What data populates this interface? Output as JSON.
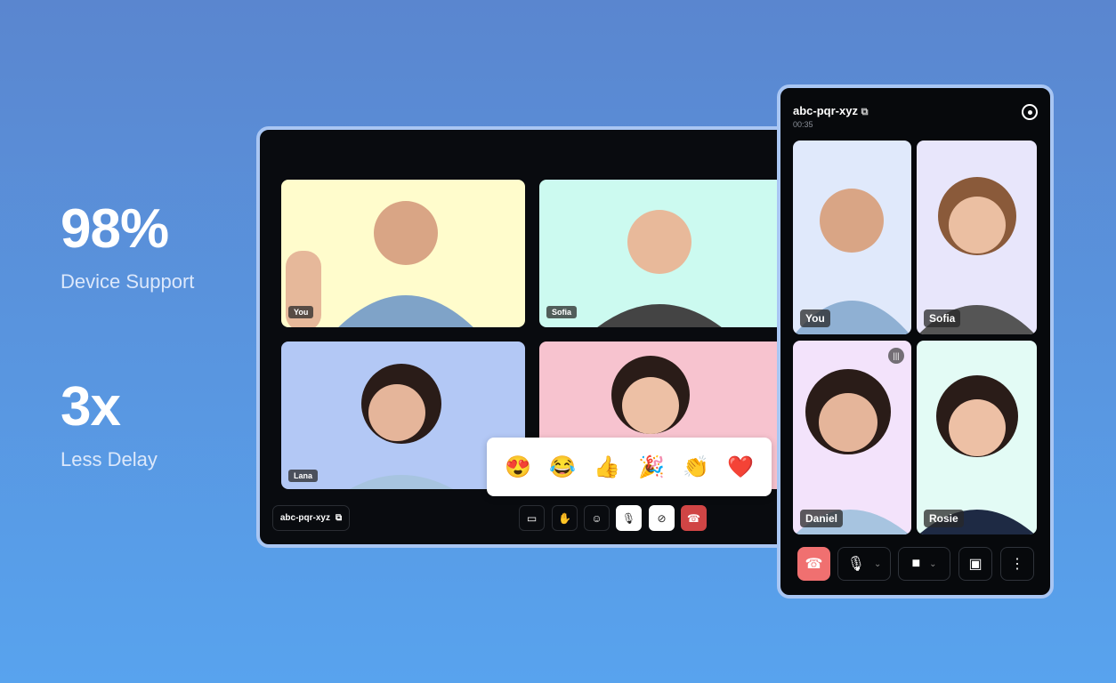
{
  "stats": [
    {
      "value": "98%",
      "label": "Device Support"
    },
    {
      "value": "3x",
      "label": "Less Delay"
    }
  ],
  "desktop": {
    "tiles": [
      {
        "name": "You",
        "color": "#fffccc"
      },
      {
        "name": "Sofia",
        "color": "#ccfaf0"
      },
      {
        "name": "Lana",
        "color": "#b3c8f5"
      },
      {
        "name": "",
        "color": "#f7c3cf"
      }
    ],
    "reactions": [
      "😍",
      "😂",
      "👍",
      "🎉",
      "👏",
      "❤️"
    ],
    "room_code": "abc-pqr-xyz",
    "controls": [
      "screen-share",
      "raise-hand",
      "emoji",
      "mic-off",
      "camera-off",
      "end-call"
    ]
  },
  "mobile": {
    "room_code": "abc-pqr-xyz",
    "timer": "00:35",
    "tiles": [
      {
        "name": "You",
        "color": "#e0e9fb"
      },
      {
        "name": "Sofia",
        "color": "#e8e6fb"
      },
      {
        "name": "Daniel",
        "color": "#f3e3fb"
      },
      {
        "name": "Rosie",
        "color": "#e3fbf5"
      }
    ],
    "end_color": "#f07070"
  }
}
